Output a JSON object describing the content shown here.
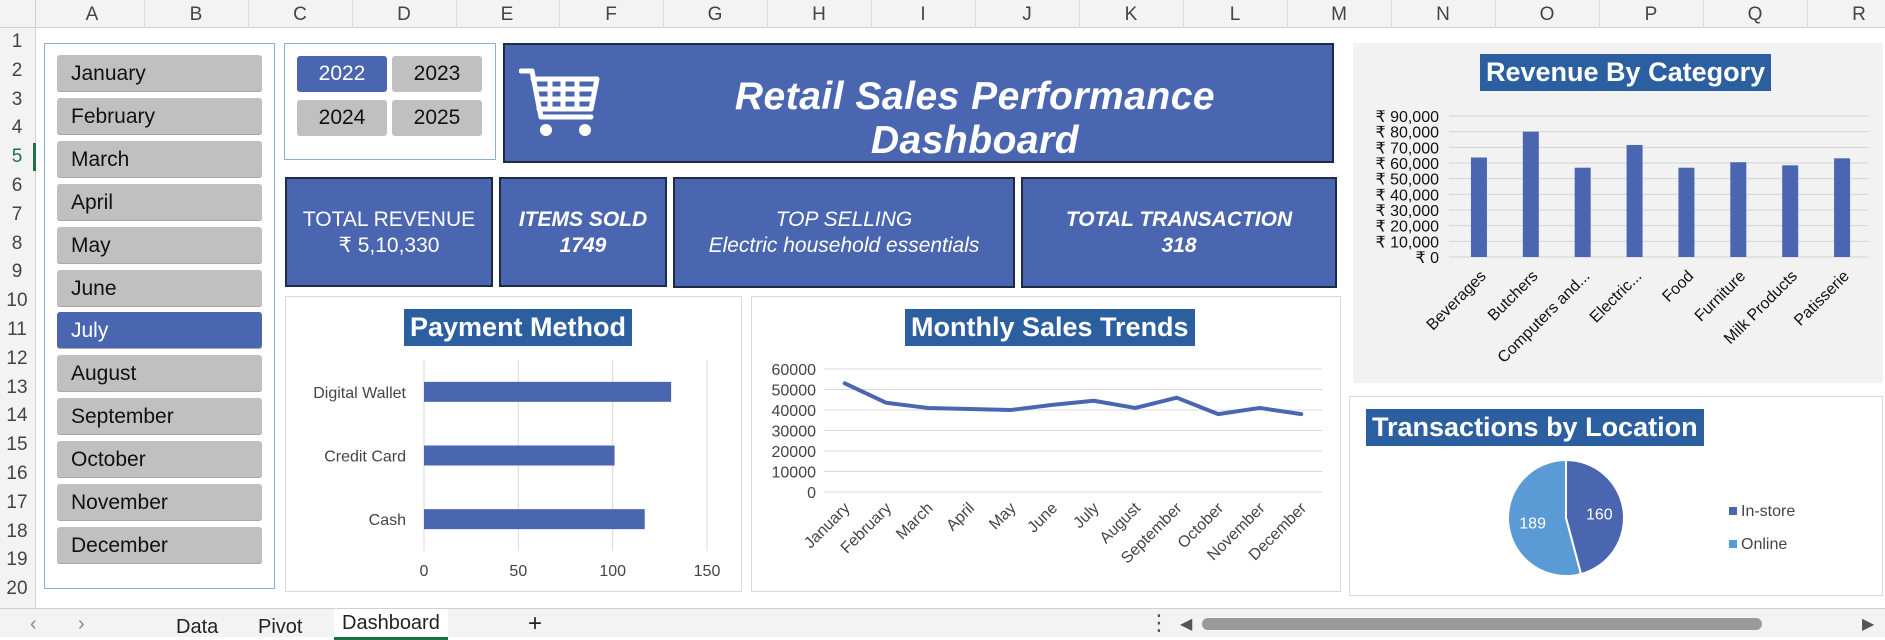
{
  "columns": [
    "A",
    "B",
    "C",
    "D",
    "E",
    "F",
    "G",
    "H",
    "I",
    "J",
    "K",
    "L",
    "M",
    "N",
    "O",
    "P",
    "Q",
    "R"
  ],
  "rows": [
    "1",
    "2",
    "3",
    "4",
    "5",
    "6",
    "7",
    "8",
    "9",
    "10",
    "11",
    "12",
    "13",
    "14",
    "15",
    "16",
    "17",
    "18",
    "19",
    "20"
  ],
  "active_row": "5",
  "months": [
    "January",
    "February",
    "March",
    "April",
    "May",
    "June",
    "July",
    "August",
    "September",
    "October",
    "November",
    "December"
  ],
  "selected_month": "July",
  "years": [
    "2022",
    "2023",
    "2024",
    "2025"
  ],
  "selected_year": "2022",
  "banner": {
    "title": "Retail Sales Performance Dashboard",
    "icon": "shopping-cart-icon"
  },
  "kpis": {
    "revenue": {
      "label": "TOTAL REVENUE",
      "value": "₹ 5,10,330"
    },
    "items": {
      "label": "ITEMS SOLD",
      "value": "1749"
    },
    "top": {
      "label": "TOP SELLING",
      "value": "Electric household essentials"
    },
    "transactions": {
      "label": "TOTAL TRANSACTION",
      "value": "318"
    }
  },
  "colors": {
    "accent": "#4a66b0",
    "title_bg": "#2c5fa0",
    "slicer_idle": "#c0c0c0",
    "pie_light": "#5b9bd5"
  },
  "tabs": {
    "data": "Data",
    "pivot": "Pivot",
    "dashboard": "Dashboard",
    "add": "+"
  },
  "chart_data": [
    {
      "id": "payment",
      "type": "bar",
      "orientation": "horizontal",
      "title": "Payment Method",
      "categories": [
        "Digital Wallet",
        "Credit Card",
        "Cash"
      ],
      "values": [
        131,
        101,
        117
      ],
      "xlim": [
        0,
        150
      ],
      "xticks": [
        "0",
        "50",
        "100",
        "150"
      ],
      "grid": true
    },
    {
      "id": "monthly",
      "type": "line",
      "title": "Monthly Sales Trends",
      "categories": [
        "January",
        "February",
        "March",
        "April",
        "May",
        "June",
        "July",
        "August",
        "September",
        "October",
        "November",
        "December"
      ],
      "values": [
        53000,
        43500,
        41000,
        40500,
        40000,
        42500,
        44500,
        41000,
        46000,
        38000,
        41000,
        38000
      ],
      "ylim": [
        0,
        60000
      ],
      "yticks": [
        "0",
        "10000",
        "20000",
        "30000",
        "40000",
        "50000",
        "60000"
      ],
      "grid": true
    },
    {
      "id": "category",
      "type": "bar",
      "title": "Revenue By Category",
      "categories": [
        "Beverages",
        "Butchers",
        "Computers and...",
        "Electric...",
        "Food",
        "Furniture",
        "Milk Products",
        "Patisserie"
      ],
      "values": [
        63500,
        80000,
        57000,
        71500,
        57000,
        60500,
        58500,
        63000
      ],
      "ylim": [
        0,
        90000
      ],
      "yticks": [
        "₹ 0",
        "₹ 10,000",
        "₹ 20,000",
        "₹ 30,000",
        "₹ 40,000",
        "₹ 50,000",
        "₹ 60,000",
        "₹ 70,000",
        "₹ 80,000",
        "₹ 90,000"
      ],
      "grid": true
    },
    {
      "id": "location",
      "type": "pie",
      "title": "Transactions by Location",
      "labels": [
        "In-store",
        "Online"
      ],
      "values": [
        160,
        189
      ],
      "legend": "right"
    }
  ]
}
